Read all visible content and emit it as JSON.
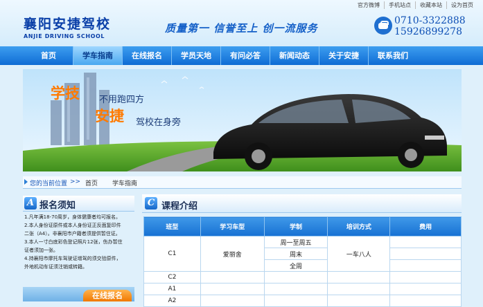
{
  "top_links": [
    "官方微博",
    "手机站点",
    "收藏本站",
    "设为首页"
  ],
  "logo": {
    "cn": "襄阳安捷驾校",
    "en": "ANJIE DRIVING SCHOOL"
  },
  "slogan": "质量第一  信誉至上  创一流服务",
  "phones": [
    "0710-3322888",
    "15926899278"
  ],
  "nav": [
    "首页",
    "学车指南",
    "在线报名",
    "学员天地",
    "有问必答",
    "新闻动态",
    "关于安捷",
    "联系我们"
  ],
  "nav_active": "学车指南",
  "banner": {
    "line1": "学技",
    "line2": "不用跑四方",
    "line3": "安捷",
    "line4": "驾校在身旁"
  },
  "breadcrumb": {
    "label": "您的当前位置",
    "sep": ">>",
    "home": "首页",
    "current": "学车指南"
  },
  "left_panel": {
    "badge": "A",
    "title": "报名须知",
    "lines": [
      "1.凡年满18-70周岁，身体健康者均可报名。",
      "2.本人身份证原件或本人身份证正反面复印件",
      "二张（A4）。非襄阳市户籍者须提供暂住证。",
      "3.本人一寸白底彩色登记照片12张，伤办暂住",
      "证者须加一张。",
      "4.持襄阳市摩托车驾驶证增驾的须交验原件，",
      "外地机动车证须注销或转籍。"
    ],
    "online_button": "在线报名"
  },
  "right_panel": {
    "badge": "C",
    "title": "课程介绍",
    "columns": [
      "班型",
      "学习车型",
      "学制",
      "培训方式",
      "费用"
    ],
    "rows": [
      {
        "class": "C1",
        "car": "爱丽舍",
        "terms": [
          "周一至周五",
          "周末",
          "全周"
        ],
        "method": "一车八人",
        "fee": ""
      },
      {
        "class": "C2",
        "car": "",
        "terms": [
          ""
        ],
        "method": "",
        "fee": ""
      },
      {
        "class": "A1",
        "car": "",
        "terms": [
          ""
        ],
        "method": "",
        "fee": ""
      },
      {
        "class": "A2",
        "car": "",
        "terms": [
          ""
        ],
        "method": "",
        "fee": ""
      }
    ]
  },
  "colors": {
    "nav_blue": "#1f7fe0",
    "accent_orange": "#ff7a00",
    "brand_blue": "#0a3fa8"
  }
}
